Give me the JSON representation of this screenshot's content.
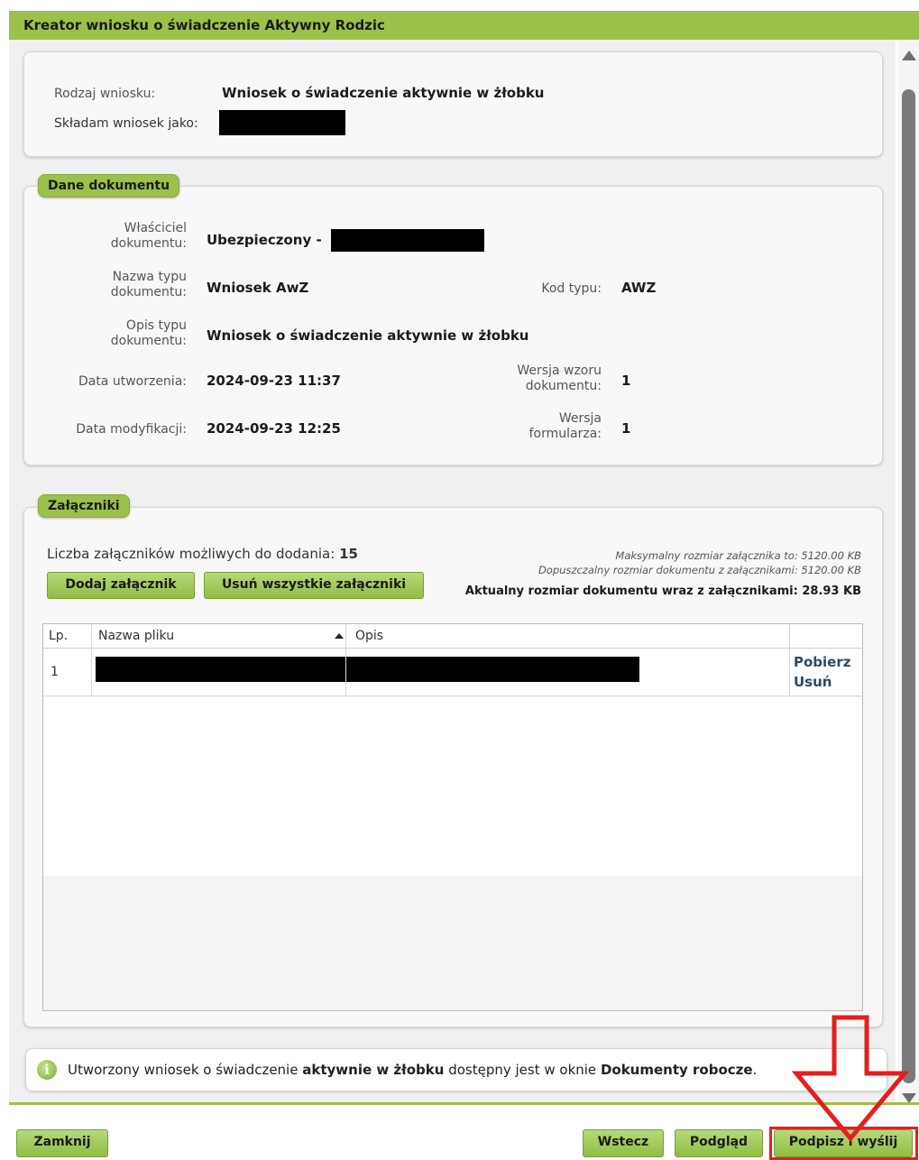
{
  "window": {
    "title": "Kreator wniosku o świadczenie Aktywny Rodzic"
  },
  "request": {
    "type_label": "Rodzaj wniosku:",
    "type_value": "Wniosek o świadczenie aktywnie w żłobku",
    "as_label": "Składam wniosek jako:"
  },
  "document": {
    "legend": "Dane dokumentu",
    "owner_label_1": "Właściciel",
    "owner_label_2": "dokumentu:",
    "owner_value": "Ubezpieczony -",
    "type_name_label_1": "Nazwa typu",
    "type_name_label_2": "dokumentu:",
    "type_name_value": "Wniosek AwZ",
    "type_code_label": "Kod typu:",
    "type_code_value": "AWZ",
    "desc_label_1": "Opis typu",
    "desc_label_2": "dokumentu:",
    "desc_value": "Wniosek o świadczenie aktywnie w żłobku",
    "created_label": "Data utworzenia:",
    "created_value": "2024-09-23 11:37",
    "template_ver_label_1": "Wersja wzoru",
    "template_ver_label_2": "dokumentu:",
    "template_ver_value": "1",
    "modified_label": "Data modyfikacji:",
    "modified_value": "2024-09-23 12:25",
    "form_ver_label_1": "Wersja",
    "form_ver_label_2": "formularza:",
    "form_ver_value": "1"
  },
  "attachments": {
    "legend": "Załączniki",
    "count_label": "Liczba załączników możliwych do dodania:",
    "count_value": "15",
    "max_size": "Maksymalny rozmiar załącznika to: 5120.00 KB",
    "allowed_size": "Dopuszczalny rozmiar dokumentu z załącznikami: 5120.00 KB",
    "current_size": "Aktualny rozmiar dokumentu wraz z załącznikami: 28.93 KB",
    "add_button": "Dodaj załącznik",
    "remove_all_button": "Usuń wszystkie załączniki",
    "columns": [
      "Lp.",
      "Nazwa pliku",
      "Opis"
    ],
    "rows": [
      {
        "lp": "1",
        "download": "Pobierz",
        "delete": "Usuń"
      }
    ]
  },
  "info": {
    "text_1": "Utworzony wniosek o świadczenie ",
    "bold_1": "aktywnie w żłobku",
    "text_2": " dostępny jest w oknie ",
    "bold_2": "Dokumenty robocze",
    "text_3": "."
  },
  "footer": {
    "close": "Zamknij",
    "back": "Wstecz",
    "preview": "Podgląd",
    "sign_send": "Podpisz i wyślij"
  },
  "icons": {
    "info": "info-icon",
    "sort": "sort-ascending-icon",
    "annotation": "red-down-arrow"
  },
  "colors": {
    "accent_green": "#9bc14a",
    "highlight_red": "#e41f1f"
  }
}
